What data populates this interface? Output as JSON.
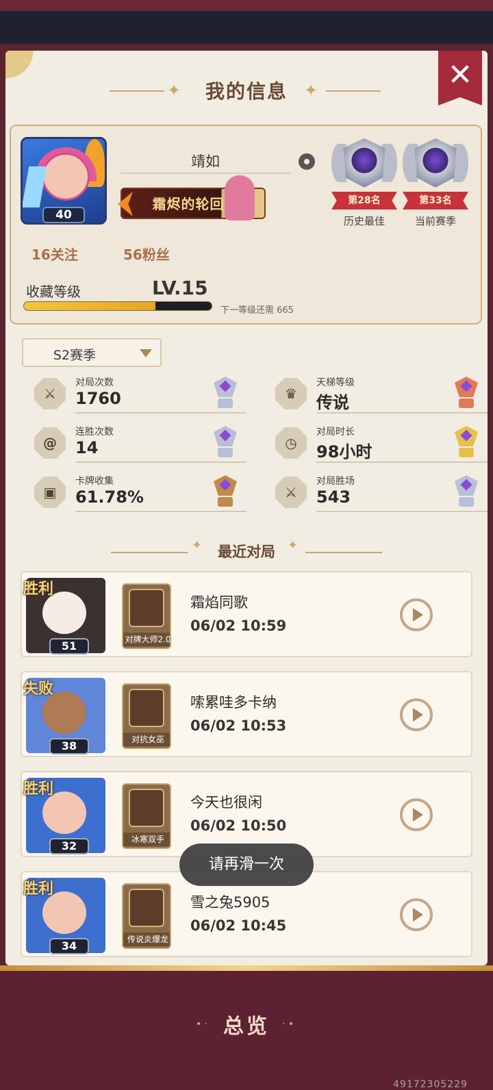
{
  "header": {
    "title": "我的信息",
    "close_label": "✕"
  },
  "profile": {
    "username": "靖如",
    "avatar_level": "40",
    "title_badge": "霜烬的轮回",
    "follow": "16关注",
    "fans": "56粉丝",
    "collection_label": "收藏等级",
    "collection_level": "LV.15",
    "collection_progress": 0.7,
    "next_level_text": "下一等级还需 665"
  },
  "ranks": [
    {
      "rank": "第28名",
      "caption": "历史最佳"
    },
    {
      "rank": "第33名",
      "caption": "当前赛季"
    }
  ],
  "season": {
    "selected": "S2赛季"
  },
  "stats": [
    {
      "label": "对局次数",
      "value": "1760",
      "icon": "swords-icon",
      "trophy_color": "#b8bfd6"
    },
    {
      "label": "天梯等级",
      "value": "传说",
      "icon": "crown-icon",
      "trophy_color": "#e07a5a"
    },
    {
      "label": "连胜次数",
      "value": "14",
      "icon": "spiral-icon",
      "trophy_color": "#b8bfd6"
    },
    {
      "label": "对局时长",
      "value": "98小时",
      "icon": "clock-icon",
      "trophy_color": "#e8c04a"
    },
    {
      "label": "卡牌收集",
      "value": "61.78%",
      "icon": "card-icon",
      "trophy_color": "#c08a4a"
    },
    {
      "label": "对局胜场",
      "value": "543",
      "icon": "swords-icon",
      "trophy_color": "#b8bfd6"
    }
  ],
  "recent": {
    "title": "最近对局",
    "matches": [
      {
        "result": "胜利",
        "level": "51",
        "deck": "对牌大师2.0",
        "opponent": "霜焰同歌",
        "time": "06/02 10:59",
        "frame": "#3a3130",
        "face": "#f5ece6"
      },
      {
        "result": "失败",
        "level": "38",
        "deck": "对抗女巫",
        "opponent": "嗦累哇多卡纳",
        "time": "06/02 10:53",
        "frame": "#5f86d8",
        "face": "#b07a54"
      },
      {
        "result": "胜利",
        "level": "32",
        "deck": "冰寒双手",
        "opponent": "今天也很闲",
        "time": "06/02 10:50",
        "frame": "#3d6fcf",
        "face": "#f3c6b4"
      },
      {
        "result": "胜利",
        "level": "34",
        "deck": "传说炎爆龙",
        "opponent": "雪之兔5905",
        "time": "06/02 10:45",
        "frame": "#3d6fcf",
        "face": "#f3c6b4"
      }
    ]
  },
  "toast": "请再滑一次",
  "bottom": {
    "overview": "总览"
  },
  "watermark": "49172305229"
}
